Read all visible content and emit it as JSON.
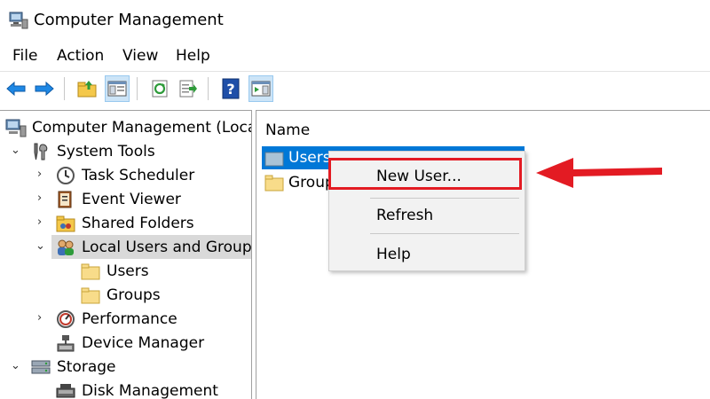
{
  "window": {
    "title": "Computer Management"
  },
  "menu": [
    "File",
    "Action",
    "View",
    "Help"
  ],
  "tree": {
    "root": "Computer Management (Local)",
    "system_tools": "System Tools",
    "task_scheduler": "Task Scheduler",
    "event_viewer": "Event Viewer",
    "shared_folders": "Shared Folders",
    "local_users_groups": "Local Users and Groups",
    "users": "Users",
    "groups": "Groups",
    "performance": "Performance",
    "device_manager": "Device Manager",
    "storage": "Storage",
    "disk_management": "Disk Management"
  },
  "list": {
    "column_name": "Name",
    "items": [
      "Users",
      "Groups"
    ]
  },
  "context_menu": {
    "new_user": "New User...",
    "refresh": "Refresh",
    "help": "Help"
  },
  "colors": {
    "selection_blue": "#0078d7",
    "annotation_red": "#e31b23",
    "toolbar_arrow_blue": "#1e88e5"
  },
  "icons": {
    "toolbar": [
      "back-arrow-icon",
      "forward-arrow-icon",
      "up-folder-icon",
      "show-hide-console-tree-icon",
      "refresh-icon",
      "export-list-icon",
      "help-icon",
      "show-hide-action-pane-icon"
    ]
  }
}
